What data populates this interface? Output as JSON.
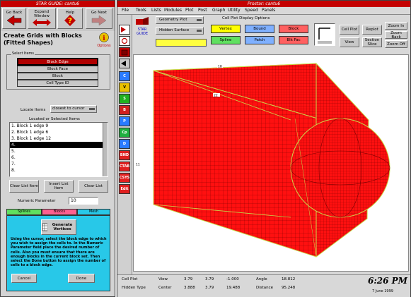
{
  "left_window": {
    "title": "STAR GUIDE: cantu6",
    "toolbar": [
      {
        "label": "Go Back",
        "icon": "back-arrow-icon"
      },
      {
        "label": "Expand Window",
        "icon": "expand-icon"
      },
      {
        "label": "Help",
        "icon": "question-icon"
      },
      {
        "label": "Go Next",
        "icon": "next-arrow-icon"
      }
    ],
    "heading": "Create Grids with Blocks (Fitted Shapes)",
    "options_label": "Options",
    "select_items_label": "Select Items",
    "select_items": [
      "Block Edge",
      "Block Face",
      "Block",
      "Cell Type ID"
    ],
    "locate_label": "Locate Items",
    "locate_value": "closest to cursor",
    "located_label": "Located or Selected Items",
    "located_items": [
      "1. Block 1 edge 9",
      "2. Block 1 edge 6",
      "3. Block 1 edge 12",
      "4.",
      "5.",
      "6.",
      "7.",
      "8."
    ],
    "list_buttons": [
      "Clear List Item",
      "Insert List Item",
      "Clear List"
    ],
    "numeric_label": "Numeric Parameter",
    "numeric_value": "10",
    "tabs": [
      "Splines",
      "Blocks",
      "Mesh"
    ],
    "generate_label": "Generate Vertices",
    "instructions": "Using the cursor, select the block edge to which you wish to assign the cells to. In the Numeric Parameter field place the desired number of cells. Also you must ensure that there are enough blocks in the current block set. Then select the Done button to assign the number of cells to a block edge.",
    "footer_buttons": [
      "Cancel",
      "Done"
    ]
  },
  "right_window": {
    "title": "Prostar: cantu6",
    "menu": [
      "File",
      "Tools",
      "Lists",
      "Modules",
      "Plot",
      "Post",
      "Graph",
      "Utility",
      "Speed",
      "Panels"
    ],
    "star_guide_label": "STAR GUIDE",
    "geometry_plot": "Geometry Plot",
    "hidden_surface": "Hidden Surface",
    "cell_plot_options": "Cell Plot Display Options",
    "display_options": [
      {
        "label": "Vertex",
        "color": "#ffff00"
      },
      {
        "label": "Bound",
        "color": "#7fb0ff"
      },
      {
        "label": "Block",
        "color": "#ff6060"
      },
      {
        "label": "Spline",
        "color": "#60e060"
      },
      {
        "label": "Patch",
        "color": "#7fb0ff"
      },
      {
        "label": "Blk Fac",
        "color": "#ff6060"
      }
    ],
    "right_buttons": [
      "Cell Plot",
      "Replot",
      "Zoom In",
      "View",
      "Section Slice",
      "Zoom Back",
      "Zoom Off"
    ],
    "side_buttons": [
      "C",
      "V",
      "S",
      "B",
      "P",
      "Cp",
      "D",
      "BND",
      "CTAB",
      "CSYS",
      "Edit"
    ],
    "axis_top": "18",
    "axis_mid": "22",
    "axis_left": "11",
    "status_row1": [
      "Cell Plot",
      "View",
      "3.79",
      "3.79",
      "-1.000",
      "Angle",
      "18.812"
    ],
    "status_row2": [
      "Hidden Type",
      "Center",
      "3.888",
      "3.79",
      "19.488",
      "Distance",
      "95.248"
    ],
    "time": "6:26 PM",
    "date": "7 June 1999"
  },
  "colors": {
    "mesh": "#ff1010",
    "mesh_line": "#7a0000",
    "edge": "#c8d84a",
    "cyan_panel": "#28c8e8"
  }
}
